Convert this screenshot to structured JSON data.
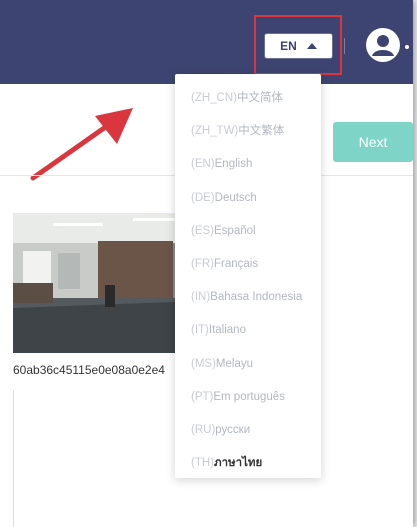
{
  "header": {
    "lang_button_label": "EN"
  },
  "toolbar": {
    "next_label": "Next"
  },
  "asset": {
    "filename": "60ab36c45115e0e08a0e2e4"
  },
  "language_menu": {
    "items": [
      {
        "code": "(ZH_CN)",
        "label": "中文简体"
      },
      {
        "code": "(ZH_TW)",
        "label": "中文繁体"
      },
      {
        "code": "(EN)",
        "label": "English"
      },
      {
        "code": "(DE)",
        "label": "Deutsch"
      },
      {
        "code": "(ES)",
        "label": "Español"
      },
      {
        "code": "(FR)",
        "label": "Français"
      },
      {
        "code": "(IN)",
        "label": "Bahasa Indonesia"
      },
      {
        "code": "(IT)",
        "label": "Italiano"
      },
      {
        "code": "(MS)",
        "label": "Melayu"
      },
      {
        "code": "(PT)",
        "label": "Em português"
      },
      {
        "code": "(RU)",
        "label": "русски"
      },
      {
        "code": "(TH)",
        "label": "ภาษาไทย"
      }
    ],
    "active_index": 11
  },
  "colors": {
    "header_bg": "#3d4471",
    "next_button": "#7fd4c8",
    "annotation": "#d9363e"
  },
  "icons": {
    "avatar": "user-circle-icon",
    "caret": "caret-up-icon",
    "annotation_arrow": "arrow-icon"
  }
}
